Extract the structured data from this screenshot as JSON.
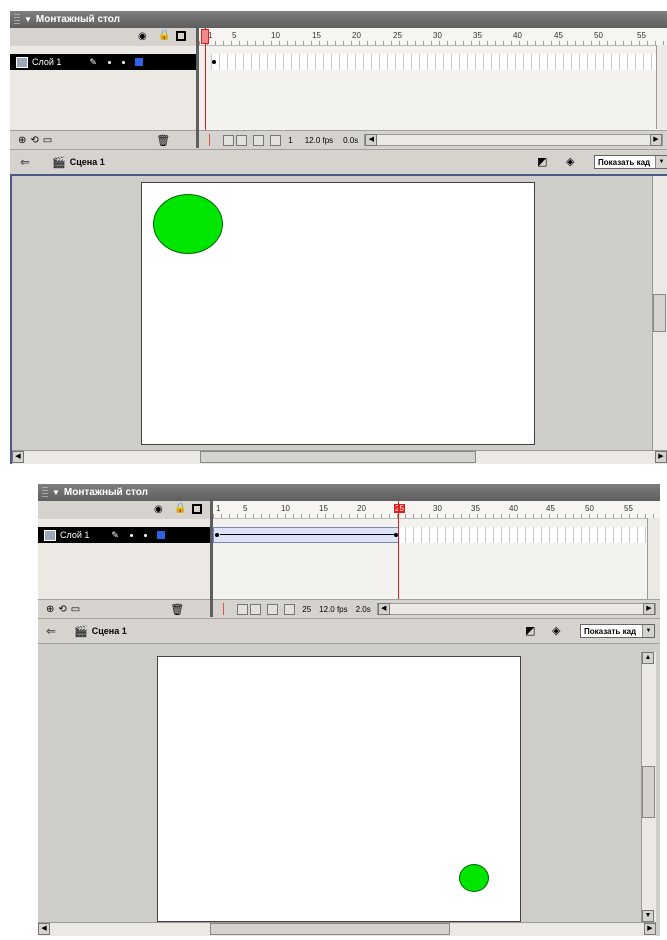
{
  "panels": [
    {
      "title": "Монтажный стол",
      "layer_name": "Слой 1",
      "ruler_ticks": [
        "1",
        "5",
        "10",
        "15",
        "20",
        "25",
        "30",
        "35",
        "40",
        "45",
        "50",
        "55"
      ],
      "current_frame": "1",
      "fps": "12.0 fps",
      "time": "0.0s",
      "scene_name": "Сцена 1",
      "view_dropdown": "Показать кад"
    },
    {
      "title": "Монтажный стол",
      "layer_name": "Слой 1",
      "ruler_ticks": [
        "1",
        "5",
        "10",
        "15",
        "20",
        "25",
        "30",
        "35",
        "40",
        "45",
        "50",
        "55"
      ],
      "current_frame": "25",
      "fps": "12.0 fps",
      "time": "2.0s",
      "scene_name": "Сцена 1",
      "view_dropdown": "Показать кад"
    }
  ],
  "colors": {
    "circle": "#00e600",
    "playhead": "#e21b1b",
    "layer_selected": "#000000",
    "tween": "#dde3f7"
  },
  "icons": {
    "eye": "eye-icon",
    "lock": "lock-icon",
    "outline": "outline-square-icon",
    "trash": "trash-icon",
    "scene": "scene-clapper-icon",
    "back": "back-arrow-icon"
  }
}
